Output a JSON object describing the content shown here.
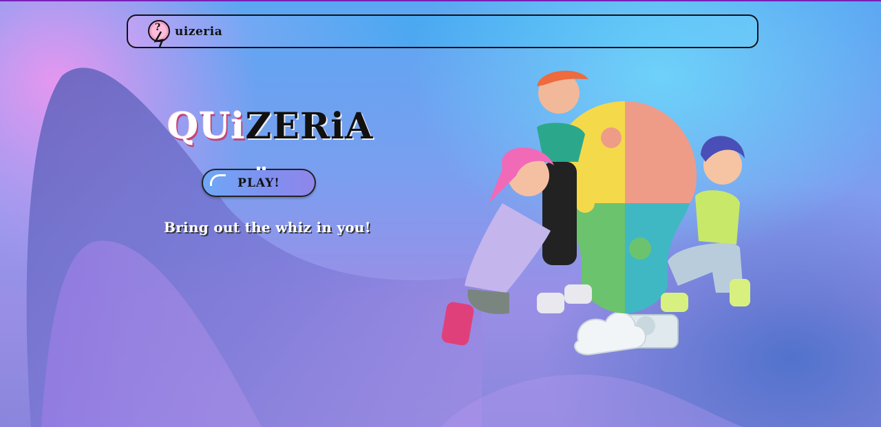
{
  "header": {
    "logo_text": "uizeria",
    "logo_icon": "question-mark-lightbulb-icon"
  },
  "hero": {
    "brand_part1": "QUi",
    "brand_part2": "ZERiA",
    "play_label": "PLAY!",
    "tagline": "Bring out the whiz in you!"
  },
  "illustration": {
    "description_icon": "team-puzzle-lightbulb-illustration"
  },
  "colors": {
    "nav_border": "#111111",
    "accent_pink": "#c2467a",
    "button_blue": "#6fa8f6",
    "top_line": "#7a1fb5"
  }
}
